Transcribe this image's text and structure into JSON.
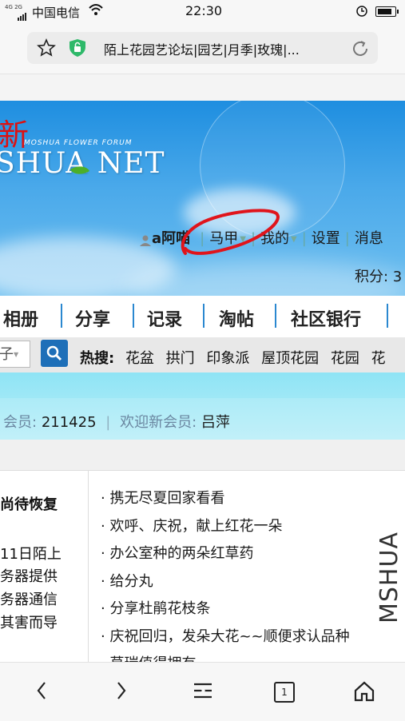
{
  "status_bar": {
    "network": "4G 2G",
    "carrier": "中国电信",
    "time": "22:30"
  },
  "browser": {
    "url_title": "陌上花园艺论坛|园艺|月季|玫瑰|..."
  },
  "banner": {
    "new_char": "新",
    "tagline": "MOSHUA FLOWER FORUM",
    "logo_text": "SHUA NET",
    "user": {
      "name": "a阿喵",
      "items": [
        "马甲",
        "我的",
        "设置",
        "消息"
      ],
      "score": "积分: 3"
    }
  },
  "nav": {
    "tabs": [
      "相册",
      "分享",
      "记录",
      "淘帖",
      "社区银行"
    ]
  },
  "search": {
    "select_text": "子",
    "hot_label": "热搜:",
    "hot_terms": [
      "花盆",
      "拱门",
      "印象派",
      "屋顶花园",
      "花园",
      "花"
    ]
  },
  "members": {
    "label": "会员:",
    "count": "211425",
    "welcome_label": "欢迎新会员:",
    "new_member": "吕萍"
  },
  "notice": {
    "heading": "尚待恢复",
    "lines": [
      "11日陌上",
      "务器提供",
      "务器通信",
      "其害而导"
    ]
  },
  "threads": [
    "· 携无尽夏回家看看",
    "· 欢呼、庆祝，献上红花一朵",
    "· 办公室种的两朵红草药",
    "· 给分丸",
    "· 分享杜鹃花枝条",
    "· 庆祝回归，发朵大花~~顺便求认品种",
    "· 草瑞值得拥有"
  ],
  "toolbar": {
    "tab_count": "1"
  },
  "watermark": "MSHUA"
}
